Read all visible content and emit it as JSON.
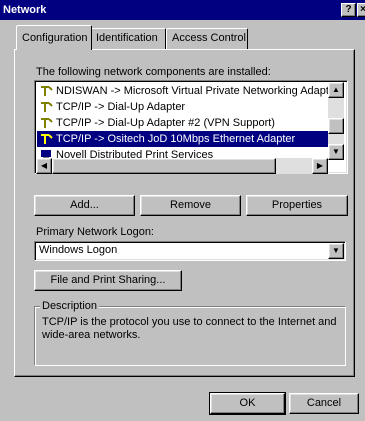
{
  "window": {
    "title": "Network",
    "help_glyph": "?",
    "close_glyph": "×"
  },
  "tabs": [
    {
      "label": "Configuration",
      "active": true
    },
    {
      "label": "Identification",
      "active": false
    },
    {
      "label": "Access Control",
      "active": false
    }
  ],
  "components": {
    "caption": "The following network components are installed:",
    "items": [
      {
        "label": "NDISWAN -> Microsoft Virtual Private Networking Adapter",
        "icon": "protocol-icon",
        "selected": false
      },
      {
        "label": "TCP/IP -> Dial-Up Adapter",
        "icon": "protocol-icon",
        "selected": false
      },
      {
        "label": "TCP/IP -> Dial-Up Adapter #2 (VPN Support)",
        "icon": "protocol-icon",
        "selected": false
      },
      {
        "label": "TCP/IP -> Ositech JoD 10Mbps Ethernet Adapter",
        "icon": "protocol-icon",
        "selected": true
      },
      {
        "label": "Novell Distributed Print Services",
        "icon": "service-icon",
        "selected": false
      }
    ]
  },
  "buttons": {
    "add": "Add...",
    "remove": "Remove",
    "properties": "Properties",
    "file_print_sharing": "File and Print Sharing...",
    "ok": "OK",
    "cancel": "Cancel"
  },
  "logon": {
    "label": "Primary Network Logon:",
    "value": "Windows Logon"
  },
  "description": {
    "title": "Description",
    "text": "TCP/IP is the protocol you use to connect to the Internet and wide-area networks."
  }
}
